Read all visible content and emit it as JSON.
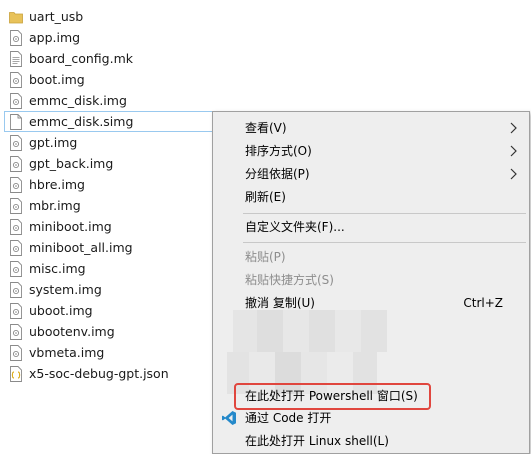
{
  "files": [
    {
      "name": "uart_usb",
      "icon": "folder-icon"
    },
    {
      "name": "app.img",
      "icon": "img-file-icon"
    },
    {
      "name": "board_config.mk",
      "icon": "text-file-icon"
    },
    {
      "name": "boot.img",
      "icon": "img-file-icon"
    },
    {
      "name": "emmc_disk.img",
      "icon": "img-file-icon"
    },
    {
      "name": "emmc_disk.simg",
      "icon": "blank-file-icon"
    },
    {
      "name": "gpt.img",
      "icon": "img-file-icon"
    },
    {
      "name": "gpt_back.img",
      "icon": "img-file-icon"
    },
    {
      "name": "hbre.img",
      "icon": "img-file-icon"
    },
    {
      "name": "mbr.img",
      "icon": "img-file-icon"
    },
    {
      "name": "miniboot.img",
      "icon": "img-file-icon"
    },
    {
      "name": "miniboot_all.img",
      "icon": "img-file-icon"
    },
    {
      "name": "misc.img",
      "icon": "img-file-icon"
    },
    {
      "name": "system.img",
      "icon": "img-file-icon"
    },
    {
      "name": "uboot.img",
      "icon": "img-file-icon"
    },
    {
      "name": "ubootenv.img",
      "icon": "img-file-icon"
    },
    {
      "name": "vbmeta.img",
      "icon": "img-file-icon"
    },
    {
      "name": "x5-soc-debug-gpt.json",
      "icon": "json-file-icon"
    }
  ],
  "menu": {
    "view": "查看(V)",
    "sort_by": "排序方式(O)",
    "group_by": "分组依据(P)",
    "refresh": "刷新(E)",
    "customize_folder": "自定义文件夹(F)...",
    "paste": "粘贴(P)",
    "paste_shortcut": "粘贴快捷方式(S)",
    "undo_copy": "撤消 复制(U)",
    "undo_copy_shortcut": "Ctrl+Z",
    "open_powershell": "在此处打开 Powershell 窗口(S)",
    "open_with_code": "通过 Code 打开",
    "open_linux_shell": "在此处打开 Linux shell(L)"
  },
  "colors": {
    "highlight_border": "#e0463e",
    "folder": "#e8c25a",
    "vscode": "#2489ca",
    "selection_border": "#99c9ef"
  }
}
